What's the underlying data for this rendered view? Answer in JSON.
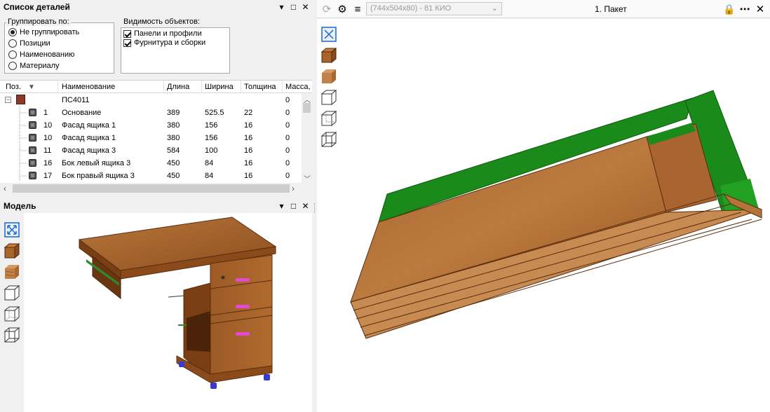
{
  "details_panel": {
    "title": "Список деталей",
    "controls": [
      "▾",
      "□",
      "✕"
    ],
    "group_by": {
      "label": "Группировать по:",
      "options": [
        {
          "label": "Не группировать",
          "selected": true
        },
        {
          "label": "Позиции",
          "selected": false
        },
        {
          "label": "Наименованию",
          "selected": false
        },
        {
          "label": "Материалу",
          "selected": false
        }
      ]
    },
    "visibility": {
      "label": "Видимость объектов:",
      "items": [
        {
          "label": "Панели и профили",
          "checked": true
        },
        {
          "label": "Фурнитура и сборки",
          "checked": true
        }
      ]
    },
    "table": {
      "columns": [
        "Поз.",
        "Наименование",
        "Длина",
        "Ширина",
        "Толщина",
        "Масса,"
      ],
      "root_row": {
        "name": "ПС4011",
        "mass": "0"
      },
      "rows": [
        {
          "pos": "1",
          "name": "Основание",
          "length": "389",
          "width": "525.5",
          "thickness": "22",
          "mass": "0"
        },
        {
          "pos": "10",
          "name": "Фасад ящика 1",
          "length": "380",
          "width": "156",
          "thickness": "16",
          "mass": "0"
        },
        {
          "pos": "10",
          "name": "Фасад ящика 1",
          "length": "380",
          "width": "156",
          "thickness": "16",
          "mass": "0"
        },
        {
          "pos": "11",
          "name": "Фасад ящика 3",
          "length": "584",
          "width": "100",
          "thickness": "16",
          "mass": "0"
        },
        {
          "pos": "16",
          "name": "Бок левый ящика 3",
          "length": "450",
          "width": "84",
          "thickness": "16",
          "mass": "0"
        },
        {
          "pos": "17",
          "name": "Бок правый ящика 3",
          "length": "450",
          "width": "84",
          "thickness": "16",
          "mass": "0"
        }
      ]
    }
  },
  "model_panel": {
    "title": "Модель",
    "controls": [
      "▾",
      "□",
      "✕"
    ],
    "tools": [
      "fit-view-icon",
      "solid-cube-icon",
      "textured-cube-icon",
      "wireframe-cube-icon",
      "hidden-lines-cube-icon",
      "transparent-cube-icon"
    ]
  },
  "viewer": {
    "combo_value": "(744x504x80) - 81 КИО",
    "title": "1. Пакет",
    "tools": [
      "fit-view-icon",
      "solid-cube-icon",
      "textured-cube-icon",
      "wireframe-cube-icon",
      "hidden-lines-cube-icon",
      "transparent-cube-icon"
    ]
  },
  "colors": {
    "wood": "#a8642b",
    "wood_dark": "#7a4118",
    "green": "#1a8a1a",
    "accent_blue": "#1e66c8"
  }
}
